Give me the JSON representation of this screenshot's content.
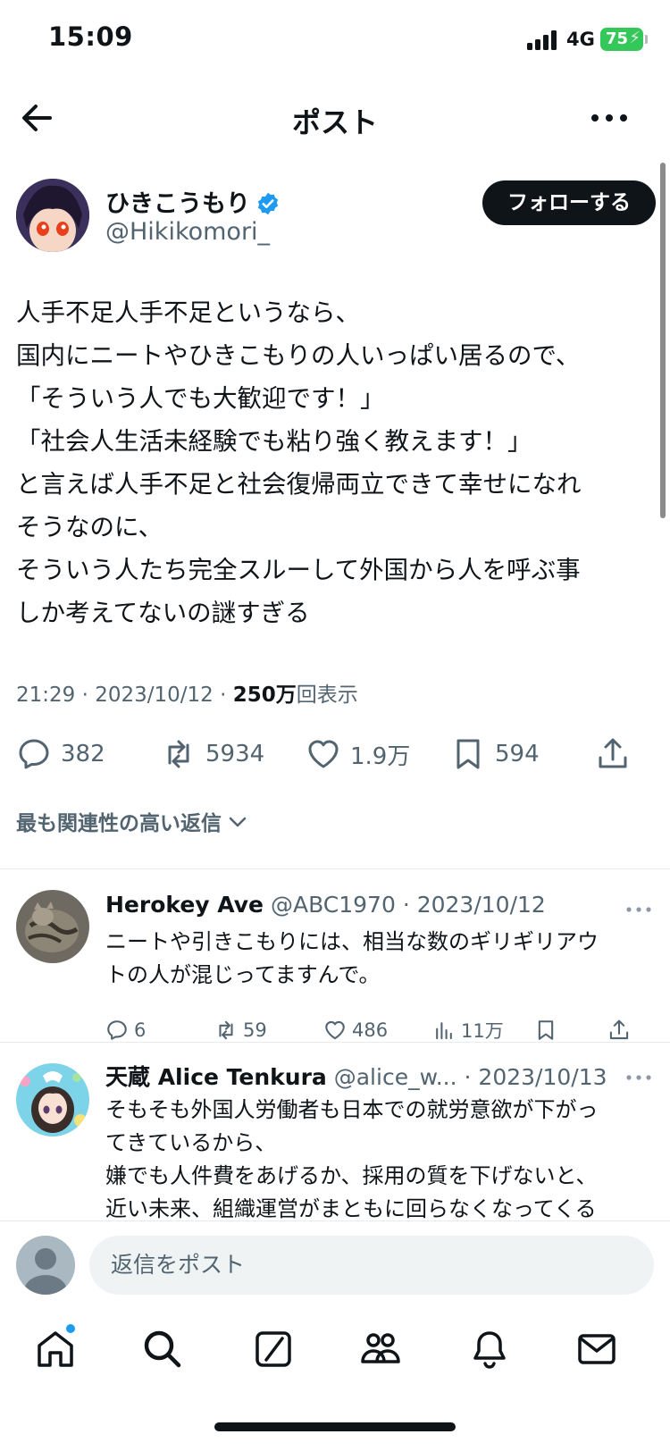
{
  "status_bar": {
    "time": "15:09",
    "network": "4G",
    "battery": "75"
  },
  "nav": {
    "title": "ポスト"
  },
  "post": {
    "author_name": "ひきこうもり",
    "author_handle": "@Hikikomori_",
    "follow_label": "フォローする",
    "lines": [
      "人手不足人手不足というなら、",
      "国内にニートやひきこもりの人いっぱい居るので、",
      "「そういう人でも大歓迎です！」",
      "「社会人生活未経験でも粘り強く教えます！」",
      "と言えば人手不足と社会復帰両立できて幸せになれ",
      "そうなのに、",
      "そういう人たち完全スルーして外国から人を呼ぶ事",
      "しか考えてないの謎すぎる"
    ],
    "time": "21:29",
    "date": "2023/10/12",
    "views": "250万",
    "views_suffix": "回表示",
    "stats": {
      "replies": "382",
      "reposts": "5934",
      "likes": "1.9万",
      "bookmarks": "594"
    }
  },
  "replies_sort": "最も関連性の高い返信",
  "replies": [
    {
      "name": "Herokey Ave",
      "handle": "@ABC1970",
      "date": "2023/10/12",
      "lines": [
        "ニートや引きこもりには、相当な数のギリギリアウ",
        "トの人が混じってますんで。"
      ],
      "stats": {
        "replies": "6",
        "reposts": "59",
        "likes": "486",
        "views": "11万"
      }
    },
    {
      "name": "天蔵 Alice Tenkura",
      "handle": "@alice_w...",
      "date": "2023/10/13",
      "lines": [
        "そもそも外国人労働者も日本での就労意欲が下がっ",
        "てきているから、",
        "嫌でも人件費をあげるか、採用の質を下げないと、",
        "近い未来、組織運営がまともに回らなくなってくる"
      ]
    }
  ],
  "composer": {
    "placeholder": "返信をポスト"
  },
  "colors": {
    "accent": "#1d9bf0",
    "text": "#0f1419",
    "muted": "#536471",
    "battery": "#34c759"
  }
}
